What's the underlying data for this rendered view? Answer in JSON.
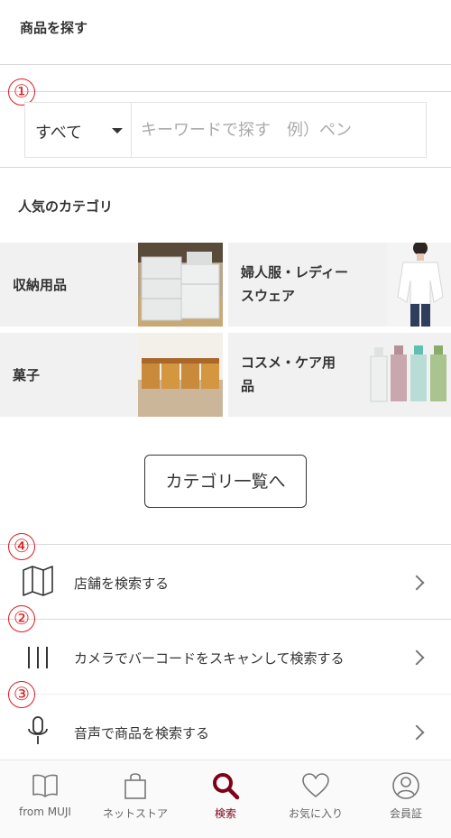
{
  "page": {
    "title": "商品を探す"
  },
  "annotations": {
    "marker1": "①",
    "marker2": "②",
    "marker3": "③",
    "marker4": "④"
  },
  "search": {
    "category_selected": "すべて",
    "placeholder": "キーワードで探す　例）ペン",
    "value": ""
  },
  "popular": {
    "heading": "人気のカテゴリ",
    "tiles": [
      {
        "line1": "収納用品",
        "line2": "",
        "image": "storage-drawers"
      },
      {
        "line1": "婦人服・レディー",
        "line2": "スウェア",
        "image": "womens-blouse"
      },
      {
        "line1": "菓子",
        "line2": "",
        "image": "baked-sweets"
      },
      {
        "line1": "コスメ・ケア用",
        "line2": "品",
        "image": "cosmetic-bottles"
      }
    ],
    "all_button": "カテゴリ一覧へ"
  },
  "rows": [
    {
      "label": "店舗を検索する",
      "icon": "map-icon"
    },
    {
      "label": "カメラでバーコードをスキャンして検索する",
      "icon": "barcode-icon"
    },
    {
      "label": "音声で商品を検索する",
      "icon": "microphone-icon"
    }
  ],
  "tabbar": {
    "tabs": [
      {
        "label": "from MUJI",
        "icon": "book-icon"
      },
      {
        "label": "ネットストア",
        "icon": "shopping-bag-icon"
      },
      {
        "label": "検索",
        "icon": "search-icon"
      },
      {
        "label": "お気に入り",
        "icon": "heart-icon"
      },
      {
        "label": "会員証",
        "icon": "user-icon"
      }
    ],
    "active_index": 2
  },
  "colors": {
    "accent": "#7f0019",
    "marker": "#e0191d",
    "tile_bg": "#f1f1f1"
  }
}
